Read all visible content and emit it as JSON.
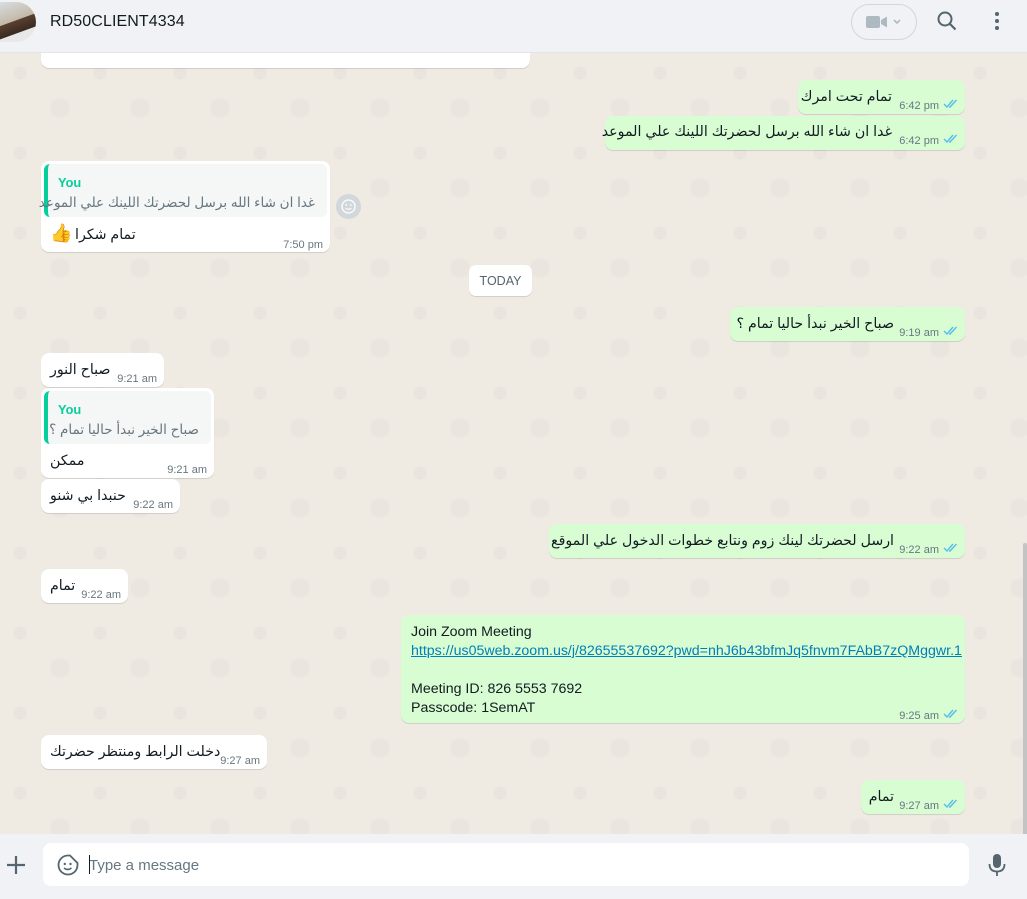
{
  "header": {
    "contact_name": "RD50CLIENT4334"
  },
  "messages": {
    "m0": {
      "text": "تمام تحت امرك",
      "time": "6:42 pm"
    },
    "m1": {
      "text": "غدا ان شاء الله برسل لحضرتك اللينك علي الموعد",
      "time": "6:42 pm"
    },
    "m2": {
      "quote_name": "You",
      "quote_text": "غدا ان شاء الله برسل لحضرتك اللينك علي الموعد",
      "text": "تمام شكرا",
      "emoji": "👍",
      "time": "7:50 pm"
    },
    "date_divider": "TODAY",
    "m3": {
      "text": "صباح الخير نبدأ حاليا تمام ؟",
      "time": "9:19 am"
    },
    "m4": {
      "text": "صباح النور",
      "time": "9:21 am"
    },
    "m5": {
      "quote_name": "You",
      "quote_text": "صباح الخير نبدأ حاليا تمام ؟",
      "text": "ممكن",
      "time": "9:21 am"
    },
    "m6": {
      "text": "حنبدا بي شنو",
      "time": "9:22 am"
    },
    "m7": {
      "text": "ارسل لحضرتك لينك زوم ونتابع خطوات الدخول علي الموقع",
      "time": "9:22 am"
    },
    "m8": {
      "text": "تمام",
      "time": "9:22 am"
    },
    "m9": {
      "line1": "Join Zoom Meeting",
      "link": "https://us05web.zoom.us/j/82655537692?pwd=nhJ6b43bfmJq5fnvm7FAbB7zQMggwr.1",
      "line3": "Meeting ID: 826 5553 7692",
      "line4": "Passcode: 1SemAT",
      "time": "9:25 am"
    },
    "m10": {
      "text": "دخلت الرابط ومنتظر حضرتك",
      "time": "9:27 am"
    },
    "m11": {
      "text": "تمام",
      "time": "9:27 am"
    }
  },
  "footer": {
    "placeholder": "Type a message"
  },
  "colors": {
    "outgoing": "#d9fdd3",
    "incoming": "#ffffff",
    "read_tick": "#53bdeb",
    "accent": "#06cf9c"
  }
}
